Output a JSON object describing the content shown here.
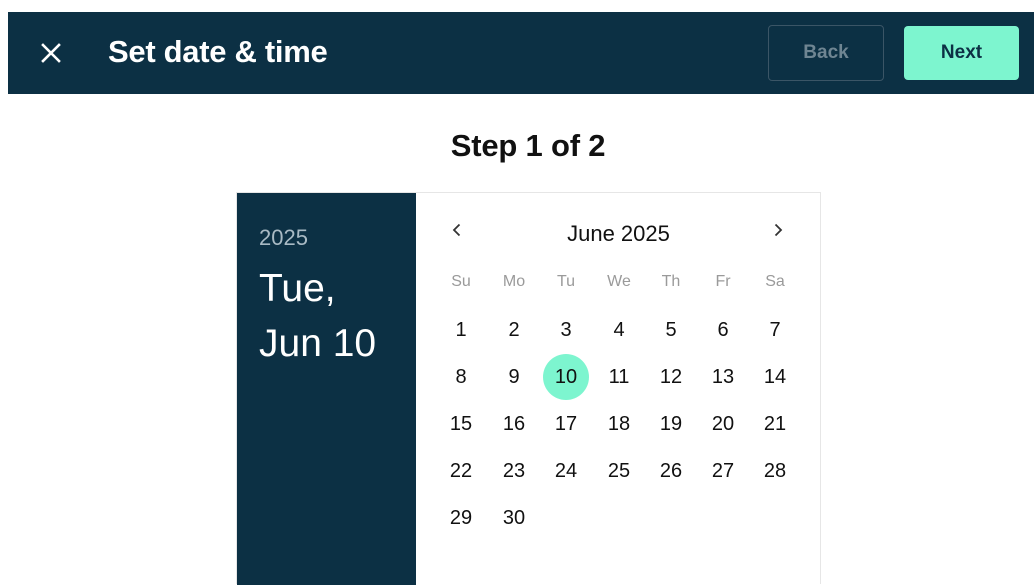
{
  "appbar": {
    "title": "Set date & time",
    "close_icon": "close-icon",
    "back_label": "Back",
    "next_label": "Next"
  },
  "step_label": "Step 1 of 2",
  "picker": {
    "year": "2025",
    "selected_date": "Tue, Jun 10",
    "month_label": "June 2025",
    "prev_icon": "chevron-left-icon",
    "next_icon": "chevron-right-icon",
    "weekdays": [
      "Su",
      "Mo",
      "Tu",
      "We",
      "Th",
      "Fr",
      "Sa"
    ],
    "first_weekday_index": 0,
    "days_in_month": 30,
    "selected_day": 10
  },
  "colors": {
    "navy": "#0c3044",
    "accent": "#7df5cf"
  }
}
